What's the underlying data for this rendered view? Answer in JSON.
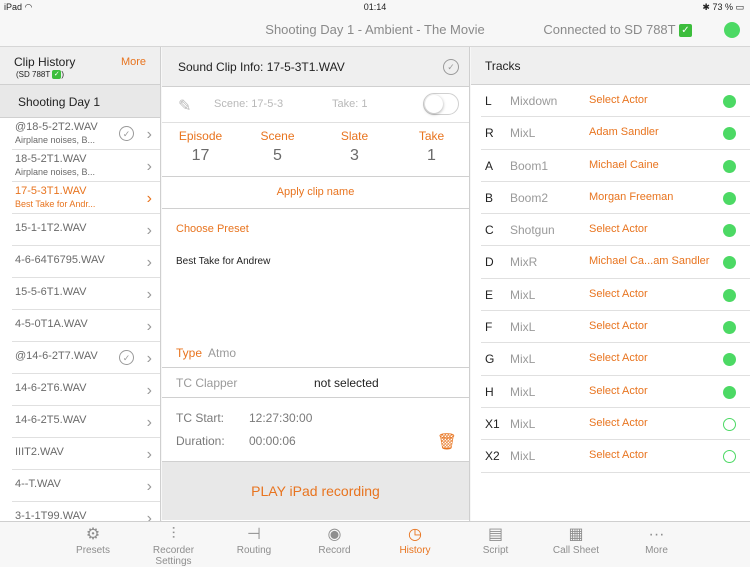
{
  "status": {
    "device": "iPad",
    "time": "01:14",
    "battery": "73 %"
  },
  "title": "Shooting Day 1 - Ambient - The Movie",
  "connection": "Connected to SD 788T",
  "left": {
    "header": "Clip History",
    "sub": "(SD 788T",
    "more": "More",
    "day": "Shooting Day 1",
    "clips": [
      {
        "name": "@18-5-2T2.WAV",
        "sub": "Airplane noises, B...",
        "checked": true
      },
      {
        "name": "18-5-2T1.WAV",
        "sub": "Airplane noises, B..."
      },
      {
        "name": "17-5-3T1.WAV",
        "sub": "Best Take for Andr...",
        "selected": true
      },
      {
        "name": "15-1-1T2.WAV"
      },
      {
        "name": "4-6-64T6795.WAV"
      },
      {
        "name": "15-5-6T1.WAV"
      },
      {
        "name": "4-5-0T1A.WAV"
      },
      {
        "name": "@14-6-2T7.WAV",
        "checked": true
      },
      {
        "name": "14-6-2T6.WAV"
      },
      {
        "name": "14-6-2T5.WAV"
      },
      {
        "name": "IIIT2.WAV"
      },
      {
        "name": "4--T.WAV"
      },
      {
        "name": "3-1-1T99.WAV"
      }
    ]
  },
  "mid": {
    "header": "Sound Clip Info: 17-5-3T1.WAV",
    "scene_ph": "Scene: 17-5-3",
    "take_ph": "Take: 1",
    "labels": {
      "episode": "Episode",
      "scene": "Scene",
      "slate": "Slate",
      "take": "Take"
    },
    "values": {
      "episode": "17",
      "scene": "5",
      "slate": "3",
      "take": "1"
    },
    "apply": "Apply clip name",
    "choose_preset": "Choose Preset",
    "preset_text": "Best Take for Andrew",
    "type_label": "Type",
    "type_value": "Atmo",
    "tc_clapper": "TC Clapper",
    "tc_clapper_value": "not selected",
    "tc_start_label": "TC Start:",
    "tc_start": "12:27:30:00",
    "duration_label": "Duration:",
    "duration": "00:00:06",
    "play": "PLAY iPad recording"
  },
  "right": {
    "header": "Tracks",
    "tracks": [
      {
        "id": "L",
        "name": "Mixdown",
        "actor": "Select Actor",
        "on": true
      },
      {
        "id": "R",
        "name": "MixL",
        "actor": "Adam Sandler",
        "on": true
      },
      {
        "id": "A",
        "name": "Boom1",
        "actor": "Michael Caine",
        "on": true
      },
      {
        "id": "B",
        "name": "Boom2",
        "actor": "Morgan Freeman",
        "on": true
      },
      {
        "id": "C",
        "name": "Shotgun",
        "actor": "Select Actor",
        "on": true
      },
      {
        "id": "D",
        "name": "MixR",
        "actor": "Michael Ca...am Sandler",
        "on": true
      },
      {
        "id": "E",
        "name": "MixL",
        "actor": "Select Actor",
        "on": true
      },
      {
        "id": "F",
        "name": "MixL",
        "actor": "Select Actor",
        "on": true
      },
      {
        "id": "G",
        "name": "MixL",
        "actor": "Select Actor",
        "on": true
      },
      {
        "id": "H",
        "name": "MixL",
        "actor": "Select Actor",
        "on": true
      },
      {
        "id": "X1",
        "name": "MixL",
        "actor": "Select Actor",
        "on": false
      },
      {
        "id": "X2",
        "name": "MixL",
        "actor": "Select Actor",
        "on": false
      }
    ]
  },
  "tabs": [
    {
      "label": "Presets",
      "icon": "gear-icon"
    },
    {
      "label": "Recorder Settings",
      "icon": "sliders-icon"
    },
    {
      "label": "Routing",
      "icon": "routing-icon"
    },
    {
      "label": "Record",
      "icon": "record-icon"
    },
    {
      "label": "History",
      "icon": "clock-icon",
      "active": true
    },
    {
      "label": "Script",
      "icon": "document-icon"
    },
    {
      "label": "Call Sheet",
      "icon": "calendar-icon"
    },
    {
      "label": "More",
      "icon": "more-icon"
    }
  ]
}
